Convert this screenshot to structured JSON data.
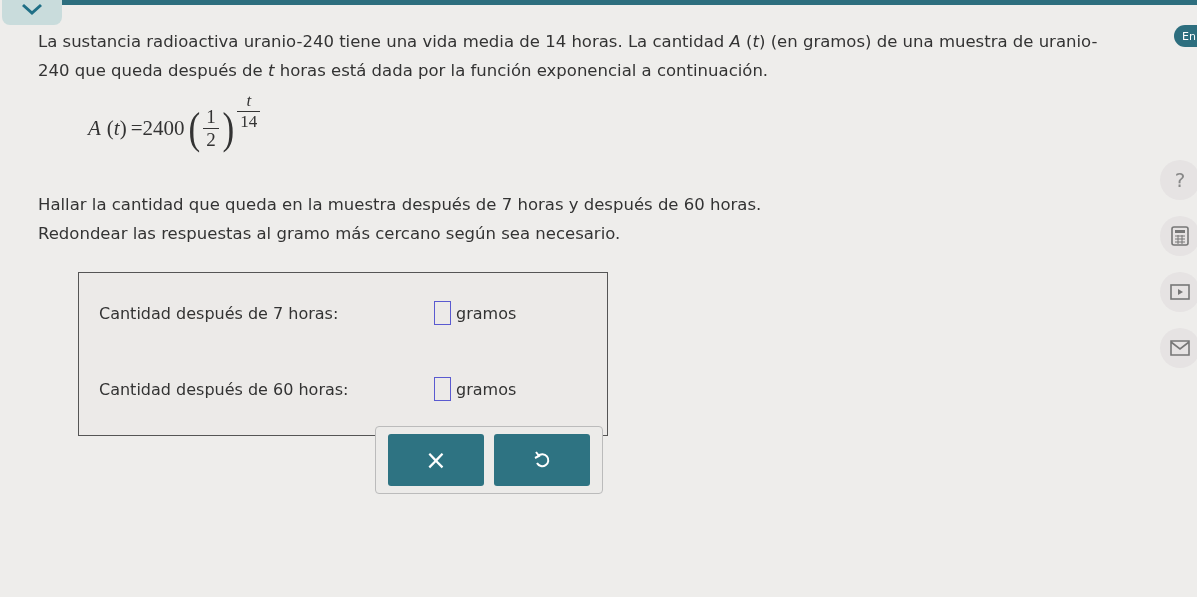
{
  "language_badge": "En",
  "problem": {
    "intro": "La sustancia radioactiva uranio-240 tiene una vida media de 14 horas. La cantidad *A* (*t*) (en gramos) de una muestra de uranio-240 que queda después de *t* horas está dada por la función exponencial a continuación.",
    "formula": {
      "name": "A",
      "open": "(",
      "variable": "t",
      "close": ")",
      "equals": "=",
      "coefficient": "2400",
      "base_open": "(",
      "base_numerator": "1",
      "base_denominator": "2",
      "base_close": ")",
      "exponent_numerator": "t",
      "exponent_denominator": "14"
    },
    "question": "Hallar la cantidad que queda en la muestra después de 7 horas y después de 60 horas.",
    "instruction": "Redondear las respuestas al gramo más cercano según sea necesario."
  },
  "answers": [
    {
      "label": "Cantidad después de 7 horas:",
      "unit": "gramos"
    },
    {
      "label": "Cantidad después de 60 horas:",
      "unit": "gramos"
    }
  ],
  "buttons": [
    {
      "kind": "clear",
      "text": "×"
    },
    {
      "kind": "undo"
    }
  ],
  "side_tools": [
    {
      "kind": "help",
      "text": "?"
    },
    {
      "kind": "calculator"
    },
    {
      "kind": "video"
    },
    {
      "kind": "message"
    }
  ]
}
